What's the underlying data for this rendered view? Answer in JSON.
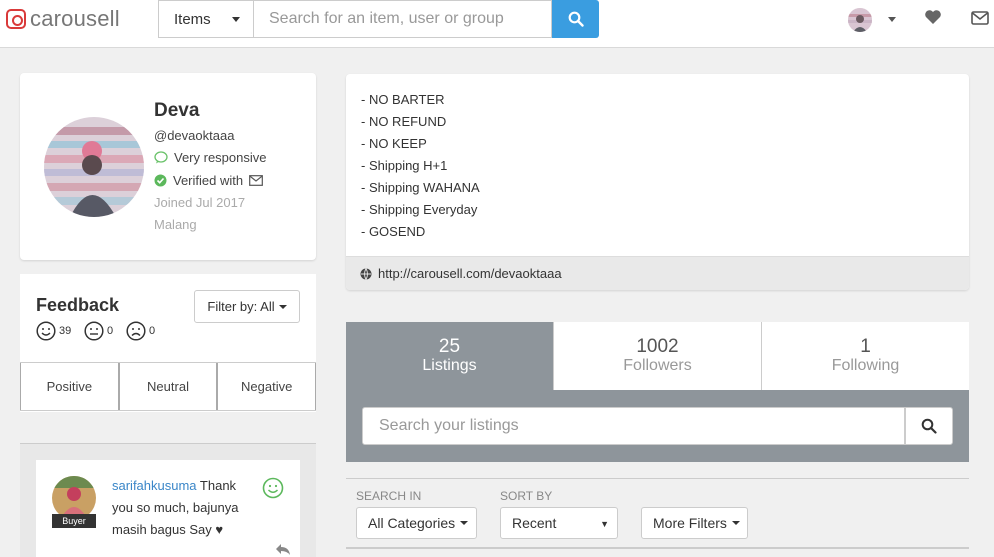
{
  "header": {
    "logo_text": "carousell",
    "category": "Items",
    "search_placeholder": "Search for an item, user or group"
  },
  "profile": {
    "name": "Deva",
    "username": "@devaoktaaa",
    "responsiveness": "Very responsive",
    "verified": "Verified with",
    "joined": "Joined Jul 2017",
    "location": "Malang"
  },
  "feedback": {
    "title": "Feedback",
    "filter_label": "Filter by: All",
    "positive_count": "39",
    "neutral_count": "0",
    "negative_count": "0",
    "tabs": [
      "Positive",
      "Neutral",
      "Negative"
    ]
  },
  "review": {
    "username": "sarifahkusuma",
    "text": " Thank you so much, bajunya masih bagus Say ♥",
    "tag": "Buyer"
  },
  "description": {
    "lines": [
      "- NO BARTER",
      "- NO REFUND",
      "- NO KEEP",
      "- Shipping H+1",
      "- Shipping WAHANA",
      "- Shipping Everyday",
      "- GOSEND"
    ],
    "link": "http://carousell.com/devaoktaaa"
  },
  "stats": [
    {
      "value": "25",
      "label": "Listings"
    },
    {
      "value": "1002",
      "label": "Followers"
    },
    {
      "value": "1",
      "label": "Following"
    }
  ],
  "listings_search": {
    "placeholder": "Search your listings"
  },
  "filters": {
    "search_in_label": "SEARCH IN",
    "search_in_value": "All Categories",
    "sort_by_label": "SORT BY",
    "sort_by_value": "Recent",
    "more_filters": "More Filters"
  },
  "colors": {
    "brand_red": "#d93a3a",
    "search_blue": "#3a9de0",
    "active_tab_gray": "#8e959b",
    "verified_green": "#5cb85c",
    "link_blue": "#3a86c8"
  },
  "icons": [
    "search-icon",
    "heart-icon",
    "mail-icon",
    "chat-icon",
    "check-circle-icon",
    "globe-icon",
    "smiley-icon",
    "neutral-face-icon",
    "frown-icon",
    "reply-icon"
  ]
}
